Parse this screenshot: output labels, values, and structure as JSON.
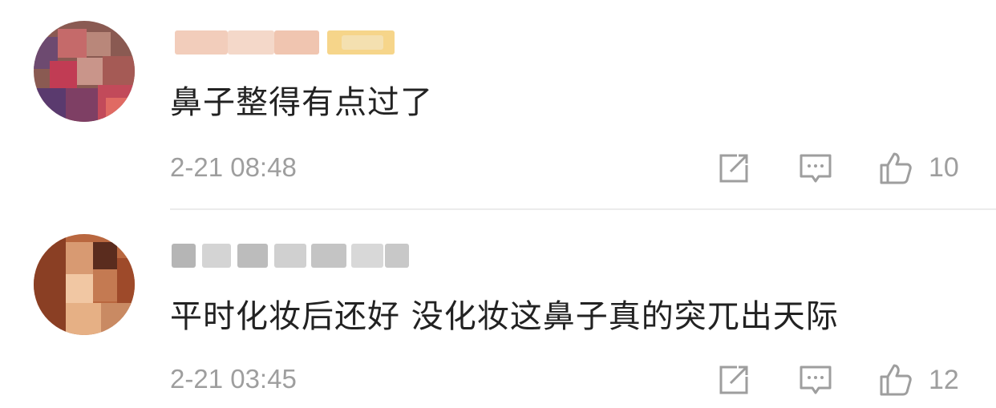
{
  "comments": [
    {
      "text": "鼻子整得有点过了",
      "time": "2-21 08:48",
      "likes": "10",
      "icons": [
        "share-icon",
        "comment-icon",
        "like-icon"
      ]
    },
    {
      "text": "平时化妆后还好 没化妆这鼻子真的突兀出天际",
      "time": "2-21 03:45",
      "likes": "12",
      "icons": [
        "share-icon",
        "comment-icon",
        "like-icon"
      ]
    }
  ],
  "colors": {
    "text": "#222222",
    "meta": "#9e9e9e",
    "divider": "#ececec"
  }
}
